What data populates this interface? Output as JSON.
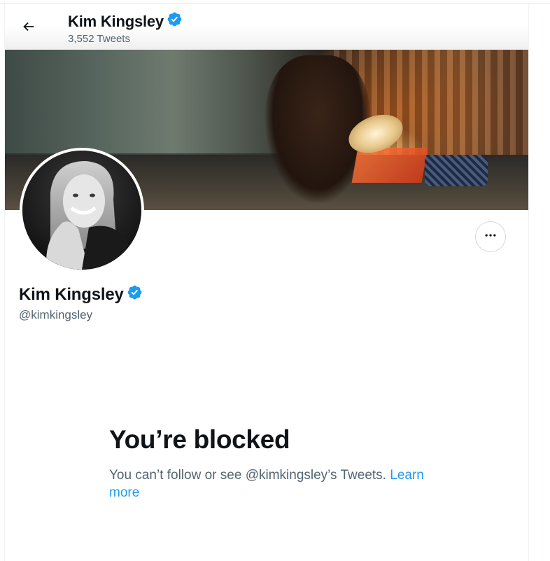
{
  "header": {
    "back_icon": "arrow-left-icon",
    "name": "Kim Kingsley",
    "tweet_count": "3,552 Tweets"
  },
  "profile": {
    "name": "Kim Kingsley",
    "handle": "@kimkingsley",
    "verified_icon": "verified-badge-icon",
    "more_icon": "more-horizontal-icon"
  },
  "blocked": {
    "title": "You’re blocked",
    "description": "You can’t follow or see @kimkingsley’s Tweets.",
    "learn_more": "Learn more"
  },
  "colors": {
    "accent": "#1d9bf0",
    "text": "#0f1419",
    "secondary_text": "#536471",
    "border": "#cfd9de"
  }
}
